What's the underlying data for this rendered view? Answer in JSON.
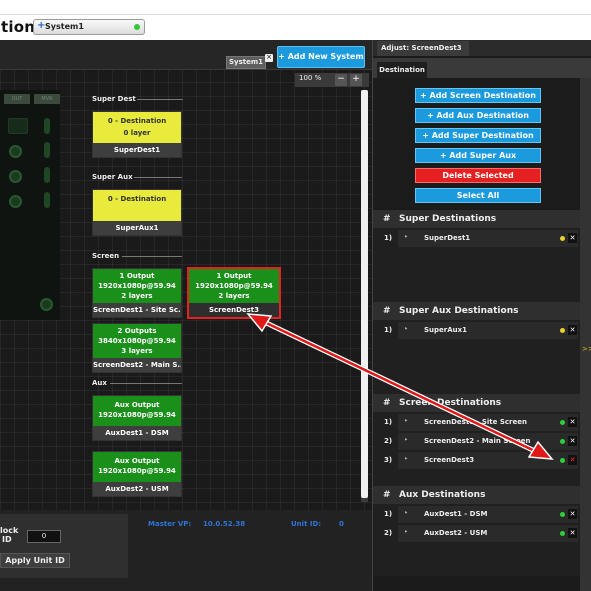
{
  "titlebar": {
    "title": "tion",
    "system_tab": {
      "plus": "+",
      "label": "System1"
    }
  },
  "canvas": {
    "system_tab_label": "System1",
    "close_glyph": "×",
    "add_system_label": "+ Add New System",
    "zoom_level": "100 %",
    "zoom_out": "−",
    "zoom_in": "+",
    "sidebar_heads": [
      "OUT",
      "MVR"
    ],
    "sections": {
      "super_dest": "Super Dest",
      "super_aux": "Super Aux",
      "screen": "Screen",
      "aux": "Aux"
    },
    "boxes": {
      "superdest1": {
        "l1": "0 - Destination",
        "l2": "0 layer",
        "name": "SuperDest1"
      },
      "superaux1": {
        "l1": "0 - Destination",
        "name": "SuperAux1"
      },
      "screendest1": {
        "l1": "1 Output",
        "l2": "1920x1080p@59.94",
        "l3": "2 layers",
        "name": "ScreenDest1 - Site Sc..."
      },
      "screendest3": {
        "l1": "1 Output",
        "l2": "1920x1080p@59.94",
        "l3": "2 layers",
        "name": "ScreenDest3"
      },
      "screendest2": {
        "l1": "2 Outputs",
        "l2": "3840x1080p@59.94",
        "l3": "3 layers",
        "name": "ScreenDest2 - Main S..."
      },
      "auxdest1": {
        "l1": "Aux Output",
        "l2": "1920x1080p@59.94",
        "name": "AuxDest1 - DSM"
      },
      "auxdest2": {
        "l1": "Aux Output",
        "l2": "1920x1080p@59.94",
        "name": "AuxDest2 - USM"
      }
    }
  },
  "bottom": {
    "block_label_1": "lock",
    "block_label_2": "ID",
    "unit_id_value": "0",
    "apply_label": "Apply Unit ID",
    "master_vp_label": "Master VP:",
    "master_vp_value": "10.0.52.38",
    "unit_id_label": "Unit ID:",
    "unit_id_value_text": "0"
  },
  "right": {
    "adjust_tab": "Adjust: ScreenDest3",
    "destination_tab": "Destination",
    "buttons": {
      "add_screen": "+ Add Screen Destination",
      "add_aux": "+ Add Aux Destination",
      "add_super": "+ Add Super Destination",
      "add_super_aux": "+ Add Super Aux",
      "delete": "Delete Selected",
      "select_all": "Select All"
    },
    "expand_glyph": ">>",
    "hash": "#",
    "caret": "‣",
    "x": "✕",
    "super_dest": {
      "title": "Super Destinations",
      "rows": [
        {
          "idx": "1)",
          "name": "SuperDest1"
        }
      ]
    },
    "super_aux": {
      "title": "Super Aux Destinations",
      "rows": [
        {
          "idx": "1)",
          "name": "SuperAux1"
        }
      ]
    },
    "screen": {
      "title": "Screen Destinations",
      "rows": [
        {
          "idx": "1)",
          "name": "ScreenDest1 - Site Screen"
        },
        {
          "idx": "2)",
          "name": "ScreenDest2 - Main Screen"
        },
        {
          "idx": "3)",
          "name": "ScreenDest3"
        }
      ]
    },
    "aux": {
      "title": "Aux Destinations",
      "rows": [
        {
          "idx": "1)",
          "name": "AuxDest1 - DSM"
        },
        {
          "idx": "2)",
          "name": "AuxDest2 - USM"
        }
      ]
    }
  },
  "colors": {
    "accent_blue": "#1b9ade",
    "delete_red": "#e52020",
    "dest_green": "#1a8f1a",
    "super_yellow": "#e8ea3c",
    "selection_red": "#e82020",
    "annotation_arrow": "#e01818"
  }
}
